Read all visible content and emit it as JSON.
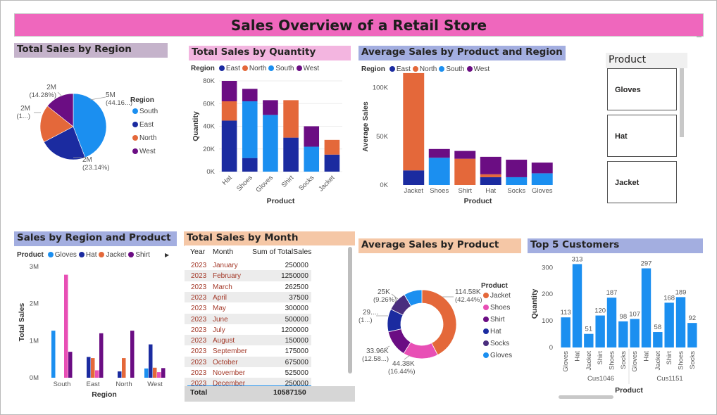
{
  "dashboard_title": "Sales Overview of a Retail Store",
  "colors": {
    "title_bg": "#ef67bd",
    "East": "#1b2ba0",
    "North": "#e4683a",
    "South": "#1b8ff0",
    "West": "#6b0d83",
    "Gloves": "#1b8ff0",
    "Hat": "#1b2ba0",
    "Jacket": "#e4683a",
    "Shirt": "#6b0d83",
    "Shoes": "#e84fb5",
    "Socks": "#4a2e7e"
  },
  "visuals": {
    "region_pie_title": "Total Sales by Region",
    "quantity_title": "Total Sales by Quantity",
    "avg_pr_title": "Average Sales by Product and Region",
    "slicer_title": "Product",
    "region_product_title": "Sales by Region and Product",
    "month_title": "Total Sales by Month",
    "avg_product_title": "Average Sales by Product",
    "customers_title": "Top 5 Customers"
  },
  "slicer": {
    "items": [
      "Gloves",
      "Hat",
      "Jacket"
    ]
  },
  "legends": {
    "region_label": "Region",
    "product_label": "Product",
    "regions": [
      "East",
      "North",
      "South",
      "West"
    ],
    "pie_regions": [
      "South",
      "East",
      "North",
      "West"
    ],
    "rp_products": [
      "Gloves",
      "Hat",
      "Jacket",
      "Shirt"
    ],
    "avg_products": [
      "Jacket",
      "Shoes",
      "Shirt",
      "Hat",
      "Socks",
      "Gloves"
    ]
  },
  "month_table": {
    "headers": [
      "Year",
      "Month",
      "Sum of TotalSales"
    ],
    "rows": [
      [
        "2023",
        "January",
        "250000"
      ],
      [
        "2023",
        "February",
        "1250000"
      ],
      [
        "2023",
        "March",
        "262500"
      ],
      [
        "2023",
        "April",
        "37500"
      ],
      [
        "2023",
        "May",
        "300000"
      ],
      [
        "2023",
        "June",
        "500000"
      ],
      [
        "2023",
        "July",
        "1200000"
      ],
      [
        "2023",
        "August",
        "150000"
      ],
      [
        "2023",
        "September",
        "175000"
      ],
      [
        "2023",
        "October",
        "675000"
      ],
      [
        "2023",
        "November",
        "525000"
      ],
      [
        "2023",
        "December",
        "250000"
      ]
    ],
    "total_label": "Total",
    "total_value": "10587150"
  },
  "chart_data": [
    {
      "id": "region_pie",
      "type": "pie",
      "title": "Total Sales by Region",
      "legend_title": "Region",
      "slices": [
        {
          "name": "South",
          "value": 44.16,
          "label": "5M",
          "pct_label": "(44.16...)"
        },
        {
          "name": "East",
          "value": 23.14,
          "label": "2M",
          "pct_label": "(23.14%)"
        },
        {
          "name": "North",
          "value": 18.42,
          "label": "2M",
          "pct_label": "(1...)"
        },
        {
          "name": "West",
          "value": 14.28,
          "label": "2M",
          "pct_label": "(14.28%)"
        }
      ]
    },
    {
      "id": "quantity",
      "type": "bar",
      "stacked": true,
      "title": "Total Sales by Quantity",
      "xlabel": "Product",
      "ylabel": "Quantity",
      "categories": [
        "Hat",
        "Shoes",
        "Gloves",
        "Shirt",
        "Socks",
        "Jacket"
      ],
      "ylim": [
        0,
        80000
      ],
      "yticks": [
        "0K",
        "20K",
        "40K",
        "60K",
        "80K"
      ],
      "series": [
        {
          "name": "East",
          "values": [
            45000,
            12000,
            0,
            30000,
            0,
            15000
          ]
        },
        {
          "name": "North",
          "values": [
            17000,
            0,
            0,
            33000,
            0,
            13000
          ]
        },
        {
          "name": "South",
          "values": [
            0,
            50000,
            50000,
            0,
            22000,
            0
          ]
        },
        {
          "name": "West",
          "values": [
            18000,
            11000,
            13000,
            0,
            18000,
            0
          ]
        }
      ]
    },
    {
      "id": "avg_product_region",
      "type": "bar",
      "stacked": true,
      "title": "Average Sales by Product and Region",
      "xlabel": "Product",
      "ylabel": "Average Sales",
      "categories": [
        "Jacket",
        "Shoes",
        "Shirt",
        "Hat",
        "Socks",
        "Gloves"
      ],
      "ylim": [
        0,
        120000
      ],
      "yticks": [
        "0K",
        "50K",
        "100K"
      ],
      "series": [
        {
          "name": "East",
          "values": [
            15000,
            0,
            0,
            8000,
            0,
            0
          ]
        },
        {
          "name": "North",
          "values": [
            100000,
            0,
            27000,
            3000,
            0,
            0
          ]
        },
        {
          "name": "South",
          "values": [
            0,
            28000,
            0,
            0,
            8000,
            12000
          ]
        },
        {
          "name": "West",
          "values": [
            0,
            9000,
            8000,
            18000,
            18000,
            11000
          ]
        }
      ]
    },
    {
      "id": "region_product",
      "type": "bar",
      "title": "Sales by Region and Product",
      "xlabel": "Region",
      "ylabel": "Total Sales",
      "categories": [
        "South",
        "East",
        "North",
        "West"
      ],
      "ylim": [
        0,
        3000000
      ],
      "yticks": [
        "0M",
        "1M",
        "2M",
        "3M"
      ],
      "series": [
        {
          "name": "Gloves",
          "values": [
            1270000,
            0,
            0,
            250000
          ]
        },
        {
          "name": "Hat",
          "values": [
            0,
            560000,
            170000,
            900000
          ]
        },
        {
          "name": "Jacket",
          "values": [
            0,
            530000,
            530000,
            270000
          ]
        },
        {
          "name": "Shoes",
          "values": [
            2780000,
            200000,
            0,
            150000
          ]
        },
        {
          "name": "Shirt",
          "values": [
            700000,
            1200000,
            1270000,
            260000
          ]
        }
      ]
    },
    {
      "id": "avg_product",
      "type": "pie",
      "donut": true,
      "title": "Average Sales by Product",
      "legend_title": "Product",
      "slices": [
        {
          "name": "Jacket",
          "value": 42.44,
          "label": "114.58K",
          "pct_label": "(42.44%)"
        },
        {
          "name": "Shoes",
          "value": 16.44,
          "label": "44.38K",
          "pct_label": "(16.44%)"
        },
        {
          "name": "Shirt",
          "value": 12.58,
          "label": "33.96K",
          "pct_label": "(12.58...)"
        },
        {
          "name": "Hat",
          "value": 10.74,
          "label": "29....",
          "pct_label": "(1...)"
        },
        {
          "name": "Socks",
          "value": 9.26,
          "label": "25K",
          "pct_label": "(9.26%)"
        },
        {
          "name": "Gloves",
          "value": 8.54,
          "label": "",
          "pct_label": ""
        }
      ]
    },
    {
      "id": "top_customers",
      "type": "bar",
      "title": "Top 5 Customers",
      "xlabel": "Product",
      "ylabel": "Quantity",
      "ylim": [
        0,
        330
      ],
      "yticks": [
        "0",
        "100",
        "200",
        "300"
      ],
      "groups": [
        "Cus1046",
        "Cus1151"
      ],
      "categories": [
        "Gloves",
        "Hat",
        "Jacket",
        "Shirt",
        "Shoes",
        "Socks",
        "Gloves",
        "Hat",
        "Jacket",
        "Shirt",
        "Shoes",
        "Socks"
      ],
      "values": [
        113,
        313,
        51,
        120,
        187,
        98,
        107,
        297,
        58,
        168,
        189,
        92
      ]
    }
  ]
}
